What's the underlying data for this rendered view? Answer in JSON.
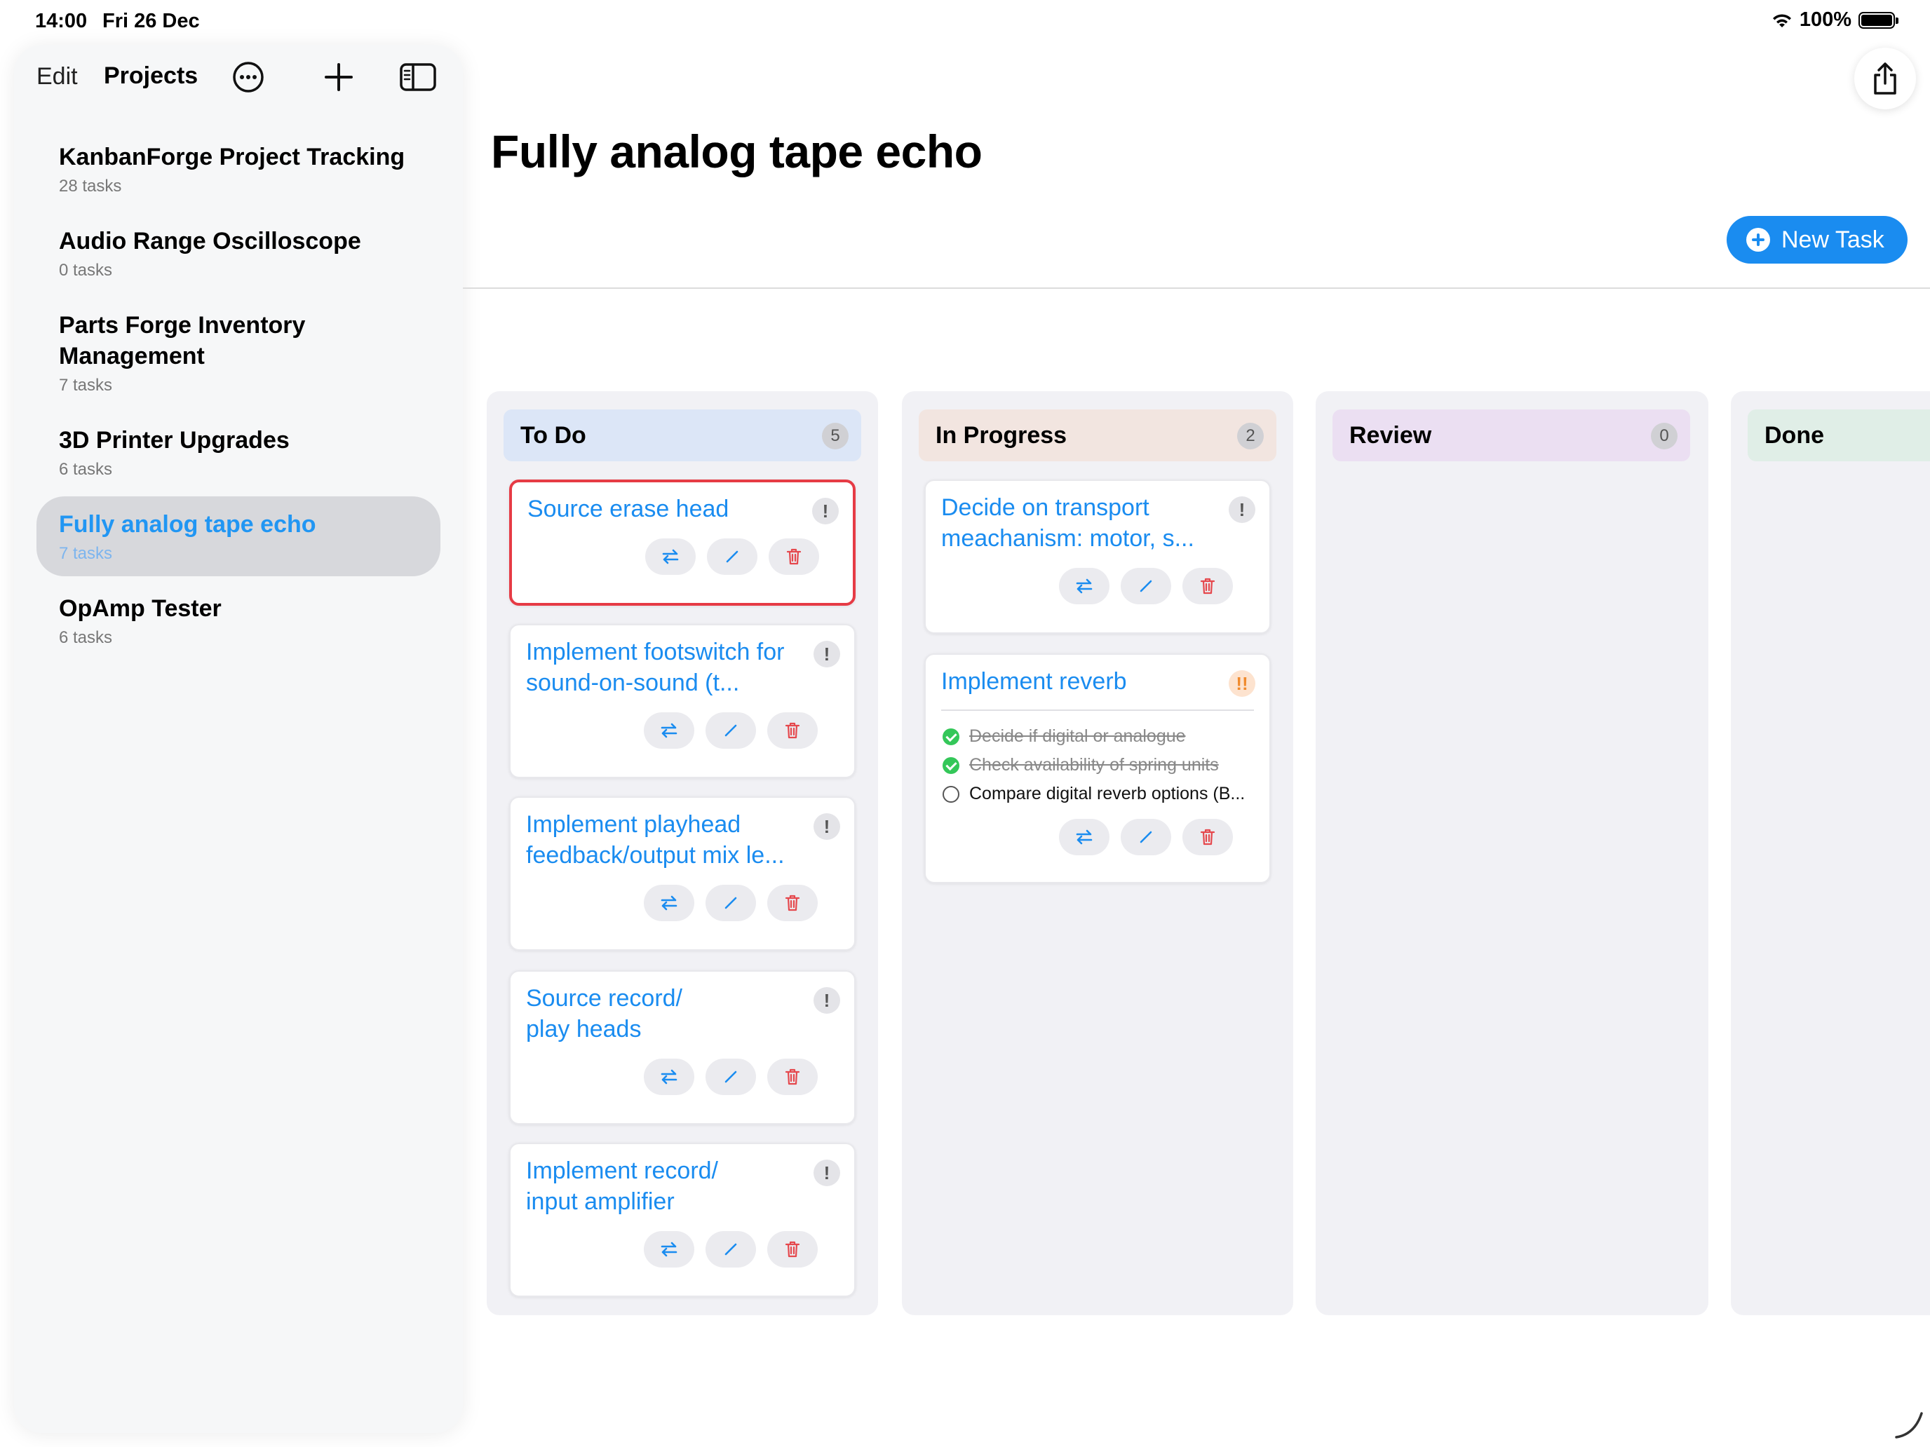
{
  "status": {
    "time": "14:00",
    "date": "Fri 26 Dec",
    "battery": "100%"
  },
  "sidebar": {
    "edit_label": "Edit",
    "title": "Projects",
    "icons": [
      "more-icon",
      "add-icon",
      "sidebar-toggle-icon"
    ],
    "items": [
      {
        "name": "KanbanForge Project Tracking",
        "count": "28 tasks"
      },
      {
        "name": "Audio Range Oscilloscope",
        "count": "0 tasks"
      },
      {
        "name": "Parts Forge Inventory Management",
        "count": "7 tasks"
      },
      {
        "name": "3D Printer Upgrades",
        "count": "6 tasks"
      },
      {
        "name": "Fully analog tape echo",
        "count": "7 tasks",
        "selected": true
      },
      {
        "name": "OpAmp Tester",
        "count": "6 tasks"
      }
    ]
  },
  "main": {
    "title": "Fully analog tape echo",
    "new_task_label": "New Task",
    "accent": "#1a8cf0"
  },
  "columns": [
    {
      "title": "To Do",
      "count": "5",
      "color": "#dce6f7",
      "cards": [
        {
          "title": "Source erase head",
          "priority": "!"
        },
        {
          "title": "Implement footswitch for sound-on-sound (t...",
          "priority": "!"
        },
        {
          "title": "Implement playhead feedback/output mix le...",
          "priority": "!"
        },
        {
          "title": "Source record/ play heads",
          "priority": "!"
        },
        {
          "title": "Implement record/ input amplifier",
          "priority": "!"
        }
      ]
    },
    {
      "title": "In Progress",
      "count": "2",
      "color": "#f2e5e0",
      "cards": [
        {
          "title": "Decide on transport meachanism: motor, s...",
          "priority": "!"
        },
        {
          "title": "Implement reverb",
          "priority": "!!",
          "subtasks": [
            {
              "label": "Decide if digital or analogue",
              "done": true
            },
            {
              "label": "Check availability of spring units",
              "done": true
            },
            {
              "label": "Compare digital reverb options (B...",
              "done": false
            }
          ]
        }
      ]
    },
    {
      "title": "Review",
      "count": "0",
      "color": "#ebdff2",
      "cards": []
    },
    {
      "title": "Done",
      "count": "",
      "color": "#e0eee7",
      "cards": []
    }
  ]
}
